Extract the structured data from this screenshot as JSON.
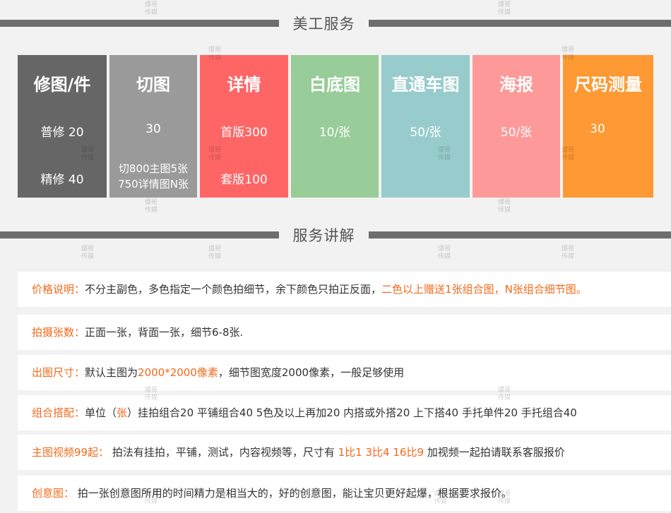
{
  "section1": {
    "title": "美工服务"
  },
  "section2": {
    "title": "服务讲解"
  },
  "cards": [
    {
      "name": "修图/件",
      "line1": "普修 20",
      "line2": "精修 40",
      "color": "#666666"
    },
    {
      "name": "切图",
      "line1": "30",
      "line2a": "切800主图5张",
      "line2b": "750详情图N张",
      "color": "#9a9a9a"
    },
    {
      "name": "详情",
      "line1": "首版300",
      "line2": "套版100",
      "color": "#fe6666"
    },
    {
      "name": "白底图",
      "line1": "10/张",
      "color": "#98cc98"
    },
    {
      "name": "直通车图",
      "line1": "50/张",
      "color": "#98cccc"
    },
    {
      "name": "海报",
      "line1": "50/张",
      "color": "#fe9999"
    },
    {
      "name": "尺码测量",
      "line1": "30",
      "color": "#fe9933"
    }
  ],
  "rows": [
    {
      "label": "价格说明：",
      "text": "不分主副色，多色指定一个颜色拍细节，余下颜色只拍正反面，",
      "highlight": "二色以上赠送1张组合图，N张组合细节图。"
    },
    {
      "label": "拍摄张数：",
      "text": "正面一张，背面一张，细节6-8张."
    },
    {
      "label": "出图尺寸：",
      "pre": "默认主图为",
      "highlight": "2000*2000像素",
      "text": "，细节图宽度2000像素，一般足够使用"
    },
    {
      "label": "组合搭配：",
      "pre": "单位（",
      "highlight": "张",
      "text": "）挂拍组合20  平铺组合40   5色及以上再加20 内搭或外搭20  上下搭40  手托单件20  手托组合40"
    },
    {
      "label": "主图视频99起：",
      "pre": " 拍法有挂拍，平铺，测试，内容视频等，尺寸有 ",
      "highlight": "1比1  3比4  16比9",
      "text": "   加视频一起拍请联系客服报价"
    },
    {
      "label": "创意图：",
      "text": "   拍一张创意图所用的时间精力是相当大的，好的创意图，能让宝贝更好起爆，根据要求报价。"
    }
  ],
  "watermark": {
    "line1": "爆哥",
    "line2": "传媒"
  }
}
